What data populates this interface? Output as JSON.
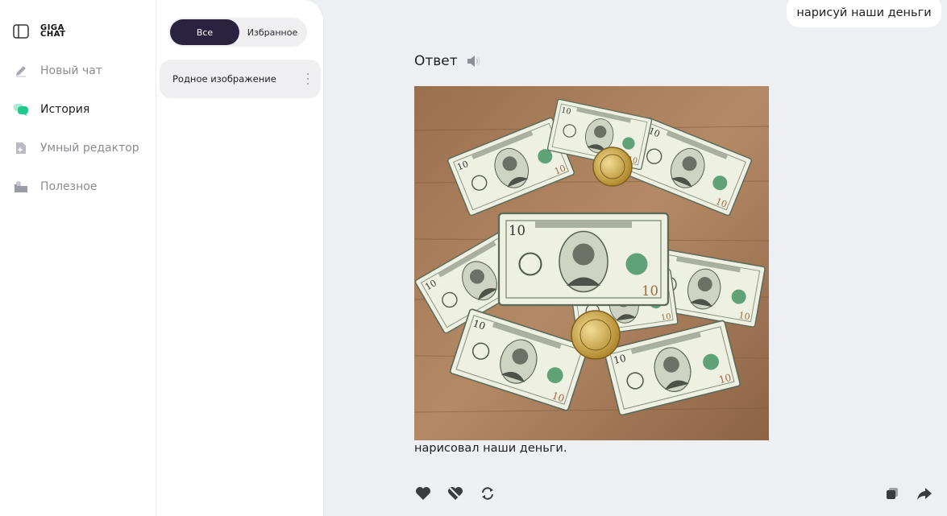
{
  "app": {
    "logo_line1": "GIGA",
    "logo_line2": "CHAT"
  },
  "nav": {
    "items": [
      {
        "label": "Новый чат",
        "icon": "pencil-icon",
        "active": false
      },
      {
        "label": "История",
        "icon": "chat-bubbles-icon",
        "active": true
      },
      {
        "label": "Умный редактор",
        "icon": "smart-editor-icon",
        "active": false
      },
      {
        "label": "Полезное",
        "icon": "useful-icon",
        "active": false
      }
    ]
  },
  "history": {
    "filter_all": "Все",
    "filter_favorites": "Избранное",
    "items": [
      {
        "title": "Родное изображение"
      }
    ]
  },
  "chat": {
    "user_message": "нарисуй наши деньги",
    "answer_label": "Ответ",
    "answer_text": "нарисовал наши деньги.",
    "image_alt_icon": "generated-money-image"
  },
  "colors": {
    "accent_dark": "#2a2340",
    "accent_green": "#21c98a",
    "background": "#eeeff2"
  }
}
